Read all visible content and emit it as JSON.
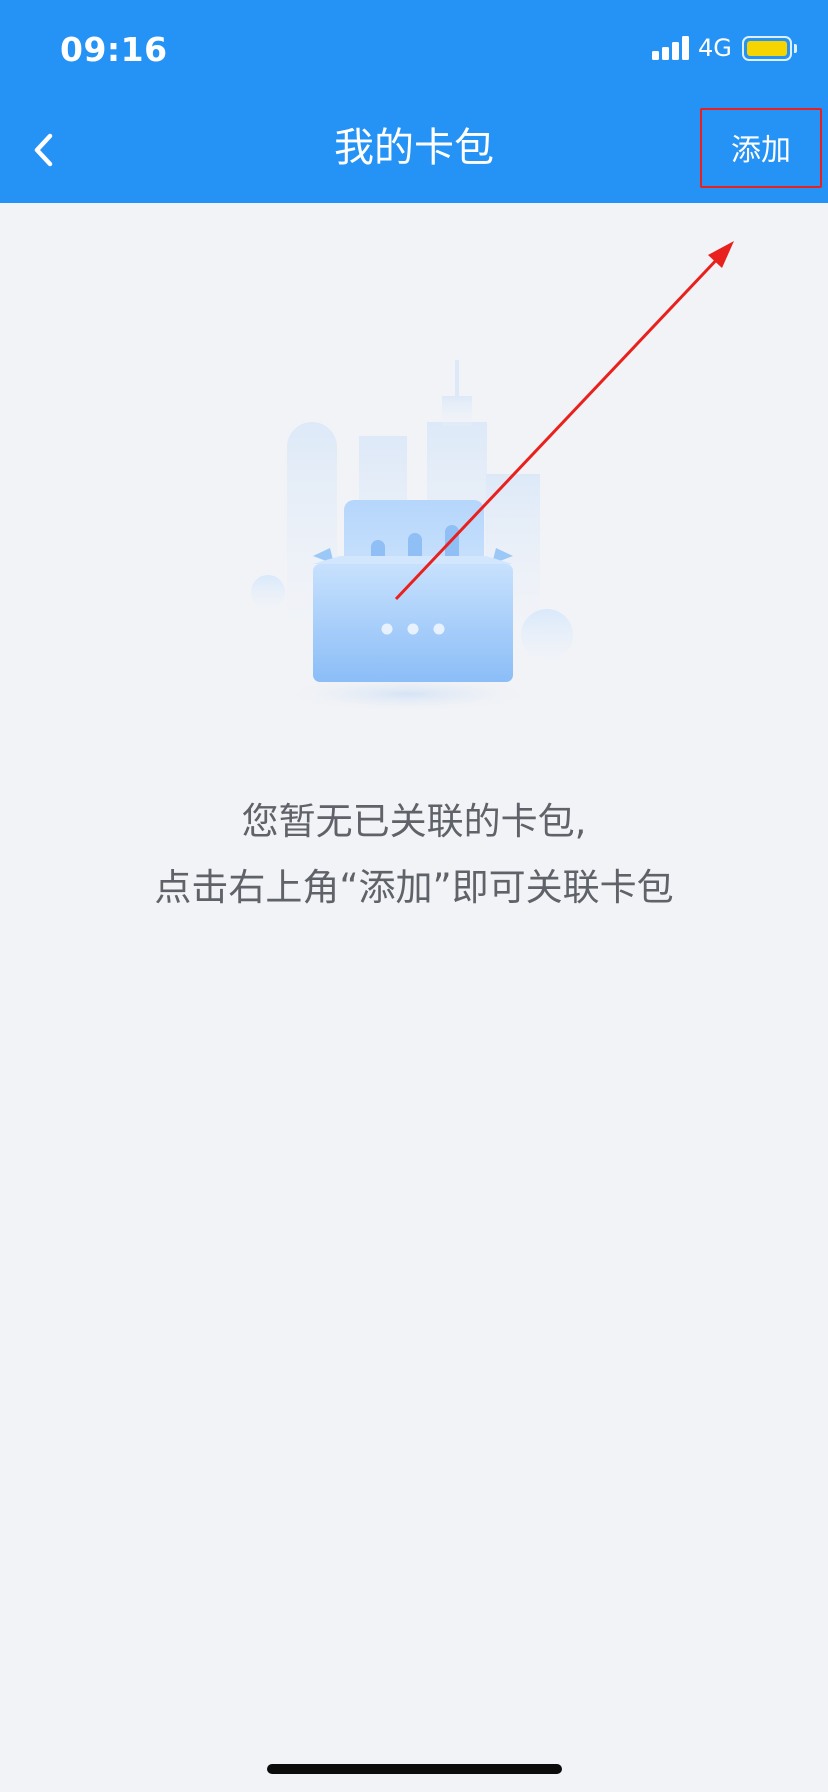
{
  "status_bar": {
    "time": "09:16",
    "network": "4G",
    "battery_color": "#f5d400"
  },
  "nav": {
    "back_icon": "chevron-left-icon",
    "title": "我的卡包",
    "add_label": "添加"
  },
  "empty_state": {
    "illustration_icon": "empty-card-wallet-illustration",
    "line1": "您暂无已关联的卡包,",
    "line2": "点击右上角“添加”即可关联卡包"
  },
  "annotation": {
    "highlight_color": "#e8211f"
  },
  "colors": {
    "header": "#2592f5",
    "background": "#f2f3f6",
    "text_muted": "#5f6269"
  }
}
